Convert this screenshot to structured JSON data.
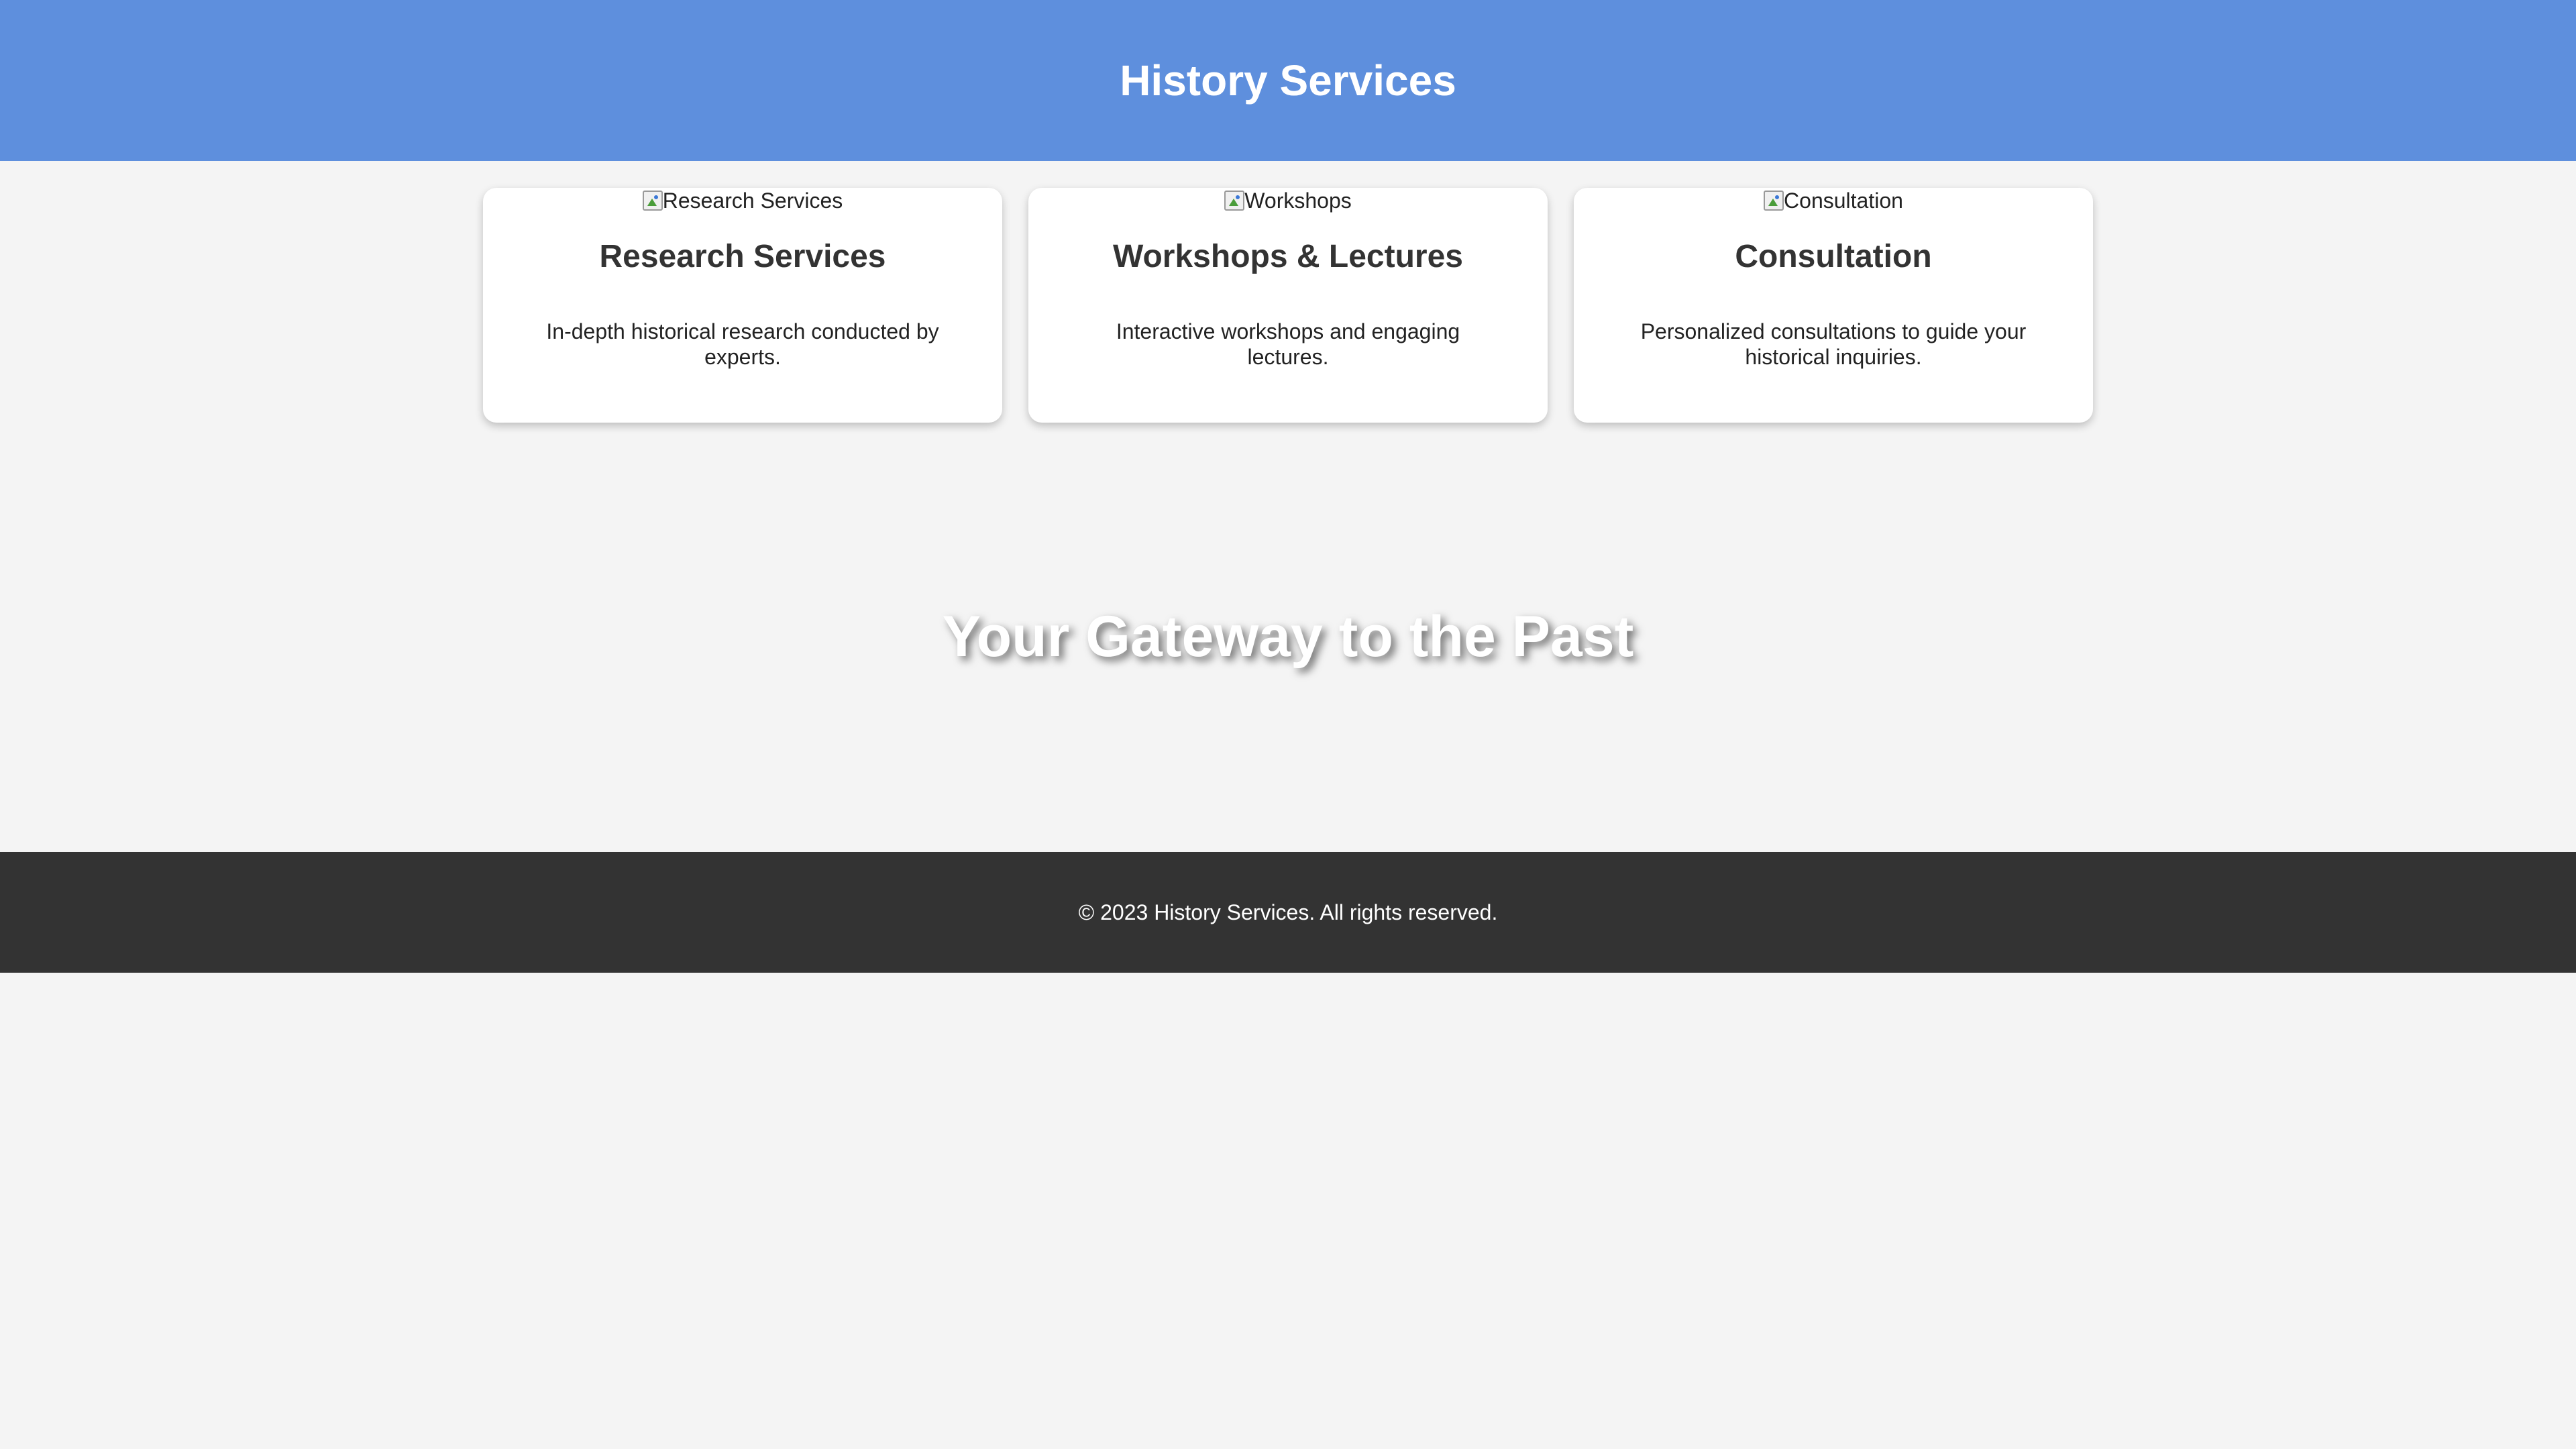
{
  "header": {
    "title": "History Services"
  },
  "services": [
    {
      "image_alt": "Research Services",
      "title": "Research Services",
      "description": "In-depth historical research conducted by experts."
    },
    {
      "image_alt": "Workshops",
      "title": "Workshops & Lectures",
      "description": "Interactive workshops and engaging lectures."
    },
    {
      "image_alt": "Consultation",
      "title": "Consultation",
      "description": "Personalized consultations to guide your historical inquiries."
    }
  ],
  "hero": {
    "heading": "Your Gateway to the Past"
  },
  "footer": {
    "text": "© 2023 History Services. All rights reserved."
  },
  "colors": {
    "header_bg": "#5e8fdd",
    "page_bg": "#f4f4f4",
    "footer_bg": "#333333"
  }
}
